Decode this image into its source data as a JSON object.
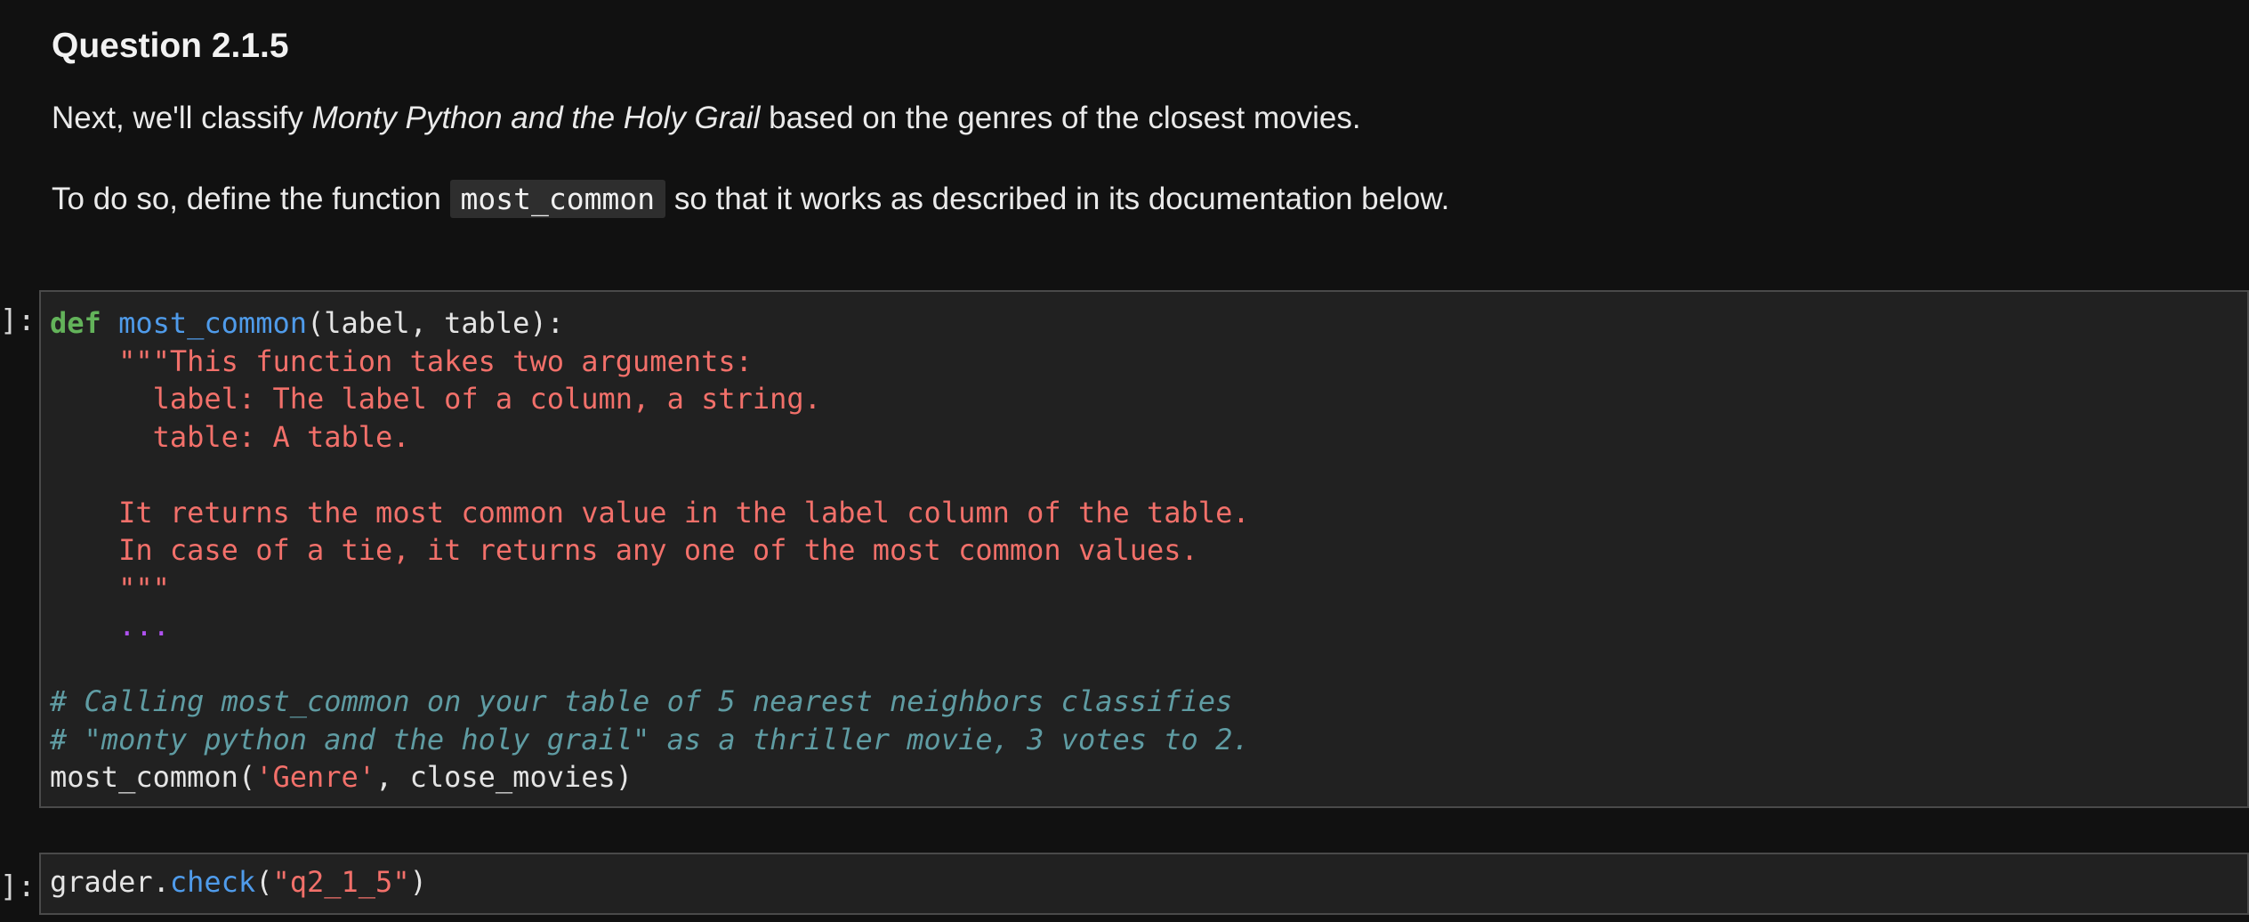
{
  "markdown": {
    "title": "Question 2.1.5",
    "para1": {
      "before": "Next, we'll classify ",
      "italic": "Monty Python and the Holy Grail",
      "after": " based on the genres of the closest movies."
    },
    "para2": {
      "before": "To do so, define the function ",
      "code": "most_common",
      "after": " so that it works as described in its documentation below."
    }
  },
  "cell1": {
    "prompt": "]:",
    "line1": {
      "kw": "def",
      "fn": "most_common",
      "rest": "(label, table):"
    },
    "docstring": [
      "    \"\"\"This function takes two arguments:",
      "      label: The label of a column, a string.",
      "      table: A table.",
      "",
      "    It returns the most common value in the label column of the table.",
      "    In case of a tie, it returns any one of the most common values.",
      "    \"\"\""
    ],
    "ellipsis": "...",
    "comment1": "# Calling most_common on your table of 5 nearest neighbors classifies",
    "comment2": "# \"monty python and the holy grail\" as a thriller movie, 3 votes to 2.",
    "call": {
      "fn": "most_common(",
      "arg": "'Genre'",
      "rest": ", close_movies)"
    }
  },
  "cell2": {
    "prompt": "]:",
    "obj": "grader.",
    "method": "check",
    "open": "(",
    "arg": "\"q2_1_5\"",
    "close": ")"
  }
}
